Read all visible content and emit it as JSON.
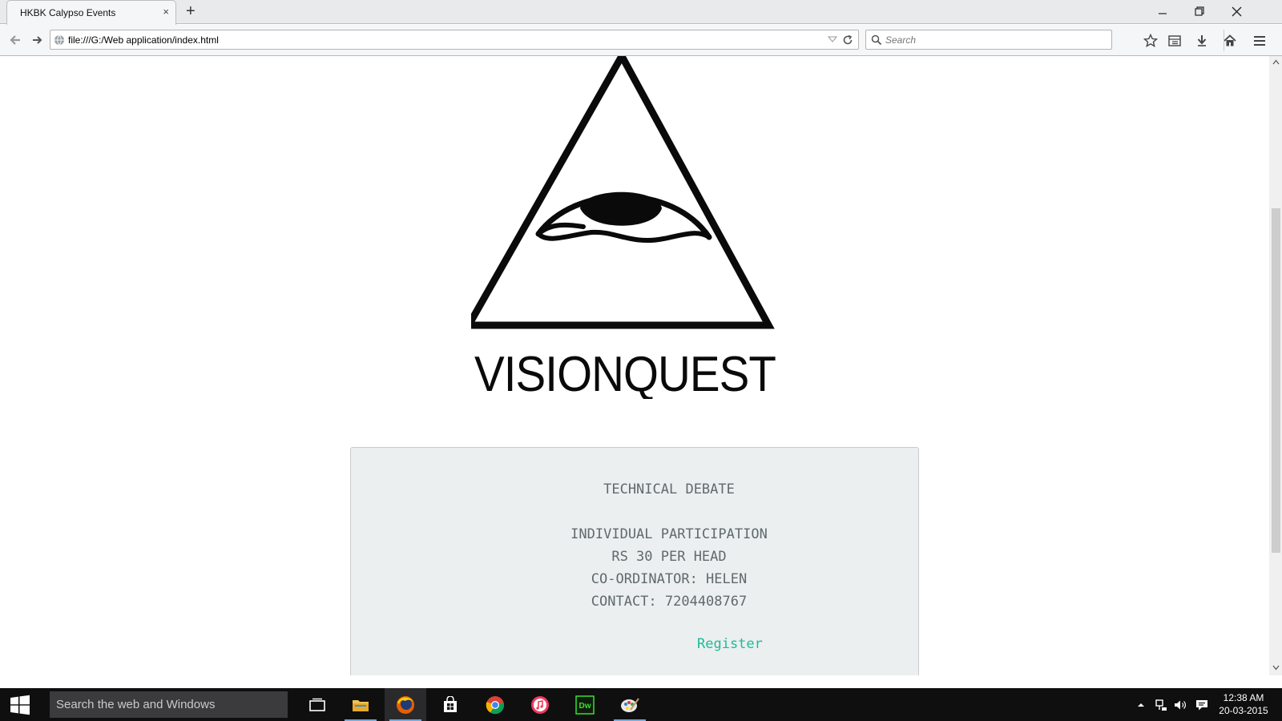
{
  "browser": {
    "tab_title": "HKBK Calypso Events",
    "tab_close": "×",
    "new_tab": "+",
    "url": "file:///G:/Web application/index.html",
    "search_placeholder": "Search"
  },
  "logo": {
    "wordmark": "VISIONQUEST"
  },
  "event": {
    "title": "TECHNICAL DEBATE",
    "participation": "INDIVIDUAL PARTICIPATION",
    "fee": "RS 30 PER HEAD",
    "coordinator": "CO-ORDINATOR: HELEN",
    "contact": "CONTACT: 7204408767",
    "register_label": "Register"
  },
  "taskbar": {
    "search_placeholder": "Search the web and Windows",
    "clock_time": "12:38 AM",
    "clock_date": "20-03-2015",
    "apps": [
      "task-view",
      "file-explorer",
      "firefox",
      "store",
      "chrome",
      "itunes",
      "dreamweaver",
      "paint"
    ]
  },
  "colors": {
    "accent_link": "#1abc9c",
    "card_bg": "#ecefef",
    "card_text": "#606a6d",
    "taskbar_bg": "#0f0f10"
  }
}
